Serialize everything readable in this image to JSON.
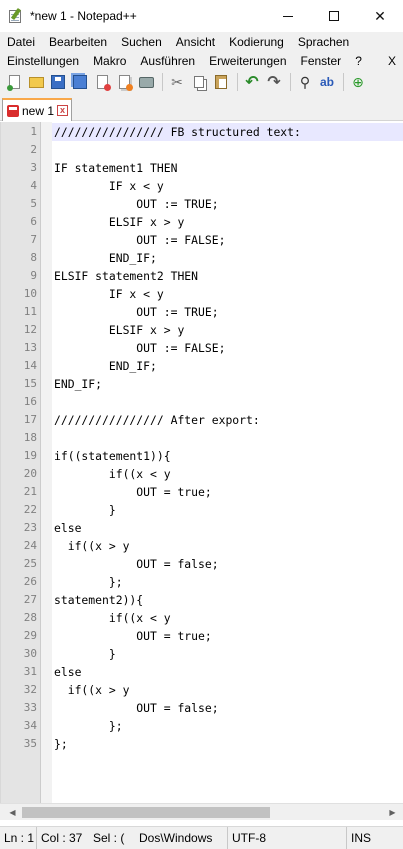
{
  "window": {
    "title": "*new 1 - Notepad++",
    "minimize_glyph": "—",
    "maximize_glyph": "☐",
    "close_glyph": "✕",
    "icon": "notepadpp-icon"
  },
  "menu": {
    "row1": [
      "Datei",
      "Bearbeiten",
      "Suchen",
      "Ansicht",
      "Kodierung",
      "Sprachen"
    ],
    "row2": [
      "Einstellungen",
      "Makro",
      "Ausführen",
      "Erweiterungen",
      "Fenster",
      "?"
    ],
    "close_label": "X"
  },
  "toolbar": {
    "icons": [
      "new-file-icon",
      "open-file-icon",
      "save-icon",
      "save-all-icon",
      "close-icon",
      "close-all-icon",
      "print-icon",
      "cut-icon",
      "copy-icon",
      "paste-icon",
      "undo-icon",
      "redo-icon",
      "find-icon",
      "replace-icon",
      "zoom-in-icon"
    ]
  },
  "tab": {
    "label": "new 1",
    "close_glyph": "x"
  },
  "editor": {
    "current_line": 1,
    "lines": [
      "//////////////// FB structured text:",
      "",
      "IF statement1 THEN",
      "        IF x < y",
      "            OUT := TRUE;",
      "        ELSIF x > y",
      "            OUT := FALSE;",
      "        END_IF;",
      "ELSIF statement2 THEN",
      "        IF x < y",
      "            OUT := TRUE;",
      "        ELSIF x > y",
      "            OUT := FALSE;",
      "        END_IF;",
      "END_IF;",
      "",
      "//////////////// After export:",
      "",
      "if((statement1)){",
      "        if((x < y",
      "            OUT = true;",
      "        }",
      "else",
      "  if((x > y",
      "            OUT = false;",
      "        };",
      "statement2)){",
      "        if((x < y",
      "            OUT = true;",
      "        }",
      "else",
      "  if((x > y",
      "            OUT = false;",
      "        };",
      "};"
    ]
  },
  "status": {
    "ln": "Ln : 1",
    "col": "Col : 37",
    "sel": "Sel : (",
    "eol": "Dos\\Windows",
    "encoding": "UTF-8",
    "mode": "INS"
  }
}
